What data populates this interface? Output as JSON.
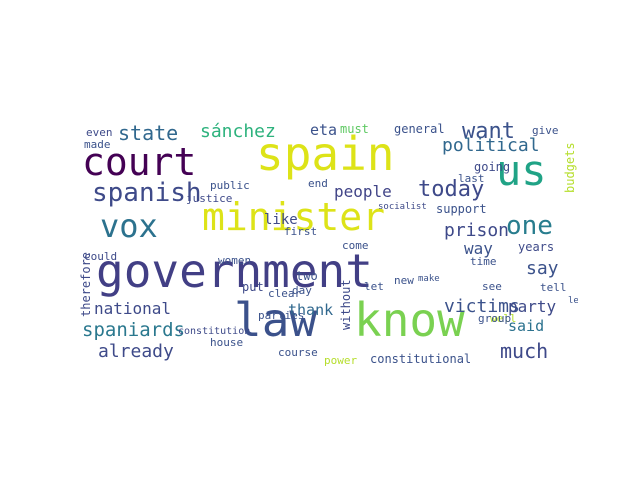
{
  "words": [
    {
      "text": "government",
      "color": "#423f85"
    },
    {
      "text": "spain",
      "color": "#dde318"
    },
    {
      "text": "law",
      "color": "#3b518b"
    },
    {
      "text": "know",
      "color": "#7ad151"
    },
    {
      "text": "minister",
      "color": "#dde318"
    },
    {
      "text": "court",
      "color": "#440154"
    },
    {
      "text": "us",
      "color": "#20a386"
    },
    {
      "text": "vox",
      "color": "#2c728e"
    },
    {
      "text": "spanish",
      "color": "#3e4a89"
    },
    {
      "text": "state",
      "color": "#31688e"
    },
    {
      "text": "sánchez",
      "color": "#2db27d"
    },
    {
      "text": "eta",
      "color": "#3b528b"
    },
    {
      "text": "want",
      "color": "#3b528b"
    },
    {
      "text": "today",
      "color": "#3e4989"
    },
    {
      "text": "one",
      "color": "#287d8e"
    },
    {
      "text": "political",
      "color": "#31688e"
    },
    {
      "text": "prison",
      "color": "#3e4989"
    },
    {
      "text": "people",
      "color": "#414487"
    },
    {
      "text": "spaniards",
      "color": "#2a788e"
    },
    {
      "text": "already",
      "color": "#3e4a89"
    },
    {
      "text": "much",
      "color": "#3e4989"
    },
    {
      "text": "victims",
      "color": "#3b528b"
    },
    {
      "text": "party",
      "color": "#3e4a89"
    },
    {
      "text": "national",
      "color": "#3e4a89"
    },
    {
      "text": "say",
      "color": "#3b528b"
    },
    {
      "text": "said",
      "color": "#2c728e"
    },
    {
      "text": "constitutional",
      "color": "#3b528b"
    },
    {
      "text": "thank",
      "color": "#31688e"
    },
    {
      "text": "like",
      "color": "#3e4a89"
    },
    {
      "text": "public",
      "color": "#3b528b"
    },
    {
      "text": "justice",
      "color": "#3e4989"
    },
    {
      "text": "general",
      "color": "#3b528b"
    },
    {
      "text": "must",
      "color": "#5ec962"
    },
    {
      "text": "give",
      "color": "#3b528b"
    },
    {
      "text": "going",
      "color": "#3e4a89"
    },
    {
      "text": "last",
      "color": "#3b528b"
    },
    {
      "text": "support",
      "color": "#3b528b"
    },
    {
      "text": "socialist",
      "color": "#3e4a89"
    },
    {
      "text": "even",
      "color": "#3e4a89"
    },
    {
      "text": "made",
      "color": "#3b528b"
    },
    {
      "text": "could",
      "color": "#3e4a89"
    },
    {
      "text": "end",
      "color": "#3b528b"
    },
    {
      "text": "two",
      "color": "#3b528b"
    },
    {
      "text": "first",
      "color": "#3b528b"
    },
    {
      "text": "day",
      "color": "#3b528b"
    },
    {
      "text": "put",
      "color": "#3e4a89"
    },
    {
      "text": "let",
      "color": "#3b528b"
    },
    {
      "text": "come",
      "color": "#3b528b"
    },
    {
      "text": "new",
      "color": "#3b528b"
    },
    {
      "text": "make",
      "color": "#3b528b"
    },
    {
      "text": "time",
      "color": "#3b528b"
    },
    {
      "text": "way",
      "color": "#3b528b"
    },
    {
      "text": "years",
      "color": "#3e4a89"
    },
    {
      "text": "tell",
      "color": "#3b528b"
    },
    {
      "text": "see",
      "color": "#3b528b"
    },
    {
      "text": "well",
      "color": "#b5de2b"
    },
    {
      "text": "left",
      "color": "#3b528b"
    },
    {
      "text": "women",
      "color": "#3b528b"
    },
    {
      "text": "parties",
      "color": "#3b528b"
    },
    {
      "text": "clear",
      "color": "#3b528b"
    },
    {
      "text": "house",
      "color": "#3b528b"
    },
    {
      "text": "course",
      "color": "#3b528b"
    },
    {
      "text": "power",
      "color": "#b5de2b"
    },
    {
      "text": "group",
      "color": "#3b528b"
    },
    {
      "text": "constitution",
      "color": "#3e4a89"
    },
    {
      "text": "therefore",
      "color": "#3e4a89"
    },
    {
      "text": "without",
      "color": "#3e4a89"
    },
    {
      "text": "budgets",
      "color": "#b5de2b"
    }
  ]
}
